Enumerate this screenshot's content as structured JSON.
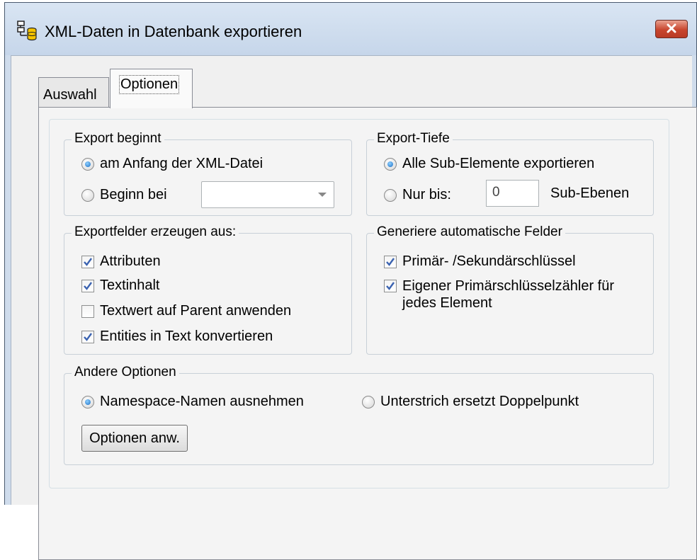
{
  "window": {
    "title": "XML-Daten in Datenbank exportieren",
    "icon": "database-export-icon",
    "close_icon": "close-icon"
  },
  "tabs": [
    {
      "label": "Auswahl",
      "active": false
    },
    {
      "label": "Optionen",
      "active": true
    }
  ],
  "export_start": {
    "label": "Export beginnt",
    "options": [
      {
        "label": "am Anfang der XML-Datei",
        "selected": true
      },
      {
        "label": "Beginn bei",
        "selected": false
      }
    ],
    "start_at_value": ""
  },
  "export_depth": {
    "label": "Export-Tiefe",
    "options": [
      {
        "label": "Alle Sub-Elemente exportieren",
        "selected": true
      },
      {
        "label": "Nur bis:",
        "selected": false
      }
    ],
    "levels_value": "0",
    "levels_suffix": "Sub-Ebenen"
  },
  "export_fields": {
    "label": "Exportfelder erzeugen aus:",
    "items": [
      {
        "label": "Attributen",
        "checked": true
      },
      {
        "label": "Textinhalt",
        "checked": true
      },
      {
        "label": "Textwert auf Parent anwenden",
        "checked": false
      },
      {
        "label": "Entities in Text konvertieren",
        "checked": true
      }
    ]
  },
  "auto_fields": {
    "label": "Generiere automatische Felder",
    "items": [
      {
        "label": "Primär- /Sekundärschlüssel",
        "checked": true
      },
      {
        "label_line1": "Eigener Primärschlüsselzähler für",
        "label_line2": "jedes Element",
        "checked": true
      }
    ]
  },
  "other_options": {
    "label": "Andere Optionen",
    "options": [
      {
        "label": "Namespace-Namen ausnehmen",
        "selected": true
      },
      {
        "label": "Unterstrich ersetzt Doppelpunkt",
        "selected": false
      }
    ],
    "apply_button": "Optionen anw."
  }
}
